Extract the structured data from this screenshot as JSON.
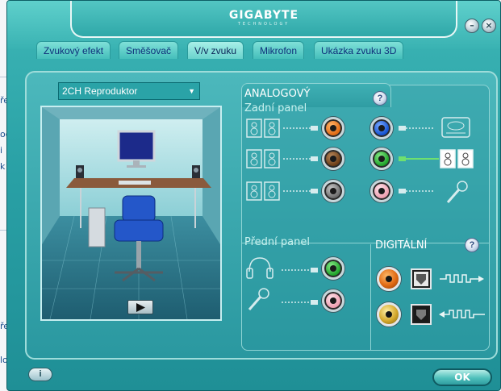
{
  "window": {
    "brand": "GIGABYTE",
    "brand_sub": "TECHNOLOGY"
  },
  "window_controls": {
    "minimize": "–",
    "close": "×"
  },
  "tabs": [
    {
      "label": "Zvukový efekt",
      "active": false
    },
    {
      "label": "Směšovač",
      "active": false
    },
    {
      "label": "V/v zvuku",
      "active": true
    },
    {
      "label": "Mikrofon",
      "active": false
    },
    {
      "label": "Ukázka zvuku 3D",
      "active": false
    }
  ],
  "speaker_config": {
    "selected": "2CH Reproduktor"
  },
  "analog": {
    "title": "ANALOGOVÝ",
    "rear_panel": "Zadní panel",
    "front_panel": "Přední panel",
    "rear_jacks": [
      {
        "color": "orange",
        "device": "speakers-icon"
      },
      {
        "color": "brown",
        "device": "speakers-icon"
      },
      {
        "color": "grey",
        "device": "speakers-icon"
      },
      {
        "color": "blue",
        "device": "line-in-icon"
      },
      {
        "color": "green",
        "device": "speakers-icon",
        "active": true
      },
      {
        "color": "pink",
        "device": "microphone-icon"
      }
    ],
    "front_jacks": [
      {
        "color": "green",
        "device": "headphones-icon"
      },
      {
        "color": "pink",
        "device": "microphone-icon"
      }
    ]
  },
  "digital": {
    "title": "DIGITÁLNÍ",
    "outputs": [
      {
        "type": "coaxial",
        "color": "orange",
        "direction": "out"
      },
      {
        "type": "coaxial",
        "color": "gold",
        "direction": "in"
      }
    ]
  },
  "buttons": {
    "ok": "OK",
    "info": "i"
  }
}
